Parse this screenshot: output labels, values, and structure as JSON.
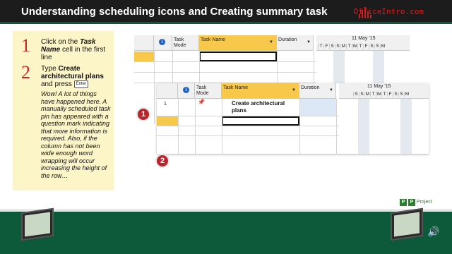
{
  "header": {
    "title": "Understanding scheduling icons and Creating summary task",
    "logo_text": "OfficeIntro.com",
    "brand_color": "#c0262c"
  },
  "steps": [
    {
      "number": "1",
      "text_pre": "Click on the ",
      "text_bold": "Task Name",
      "text_post": " cell in the first line"
    },
    {
      "number": "2",
      "text_pre": "Type ",
      "text_bold": "Create architectural plans",
      "text_post": " and press",
      "key_label": "Enter"
    }
  ],
  "note": "Wow! A lot of things have happened here. A manually scheduled task pin has appeared with a question mark indicating that more information is required. Also, if the column has not been wide enough word wrapping will occur increasing the height of the row…",
  "grid1": {
    "columns": {
      "info": "i",
      "task_mode": "Task Mode",
      "task_name": "Task Name",
      "duration": "Duration"
    },
    "timescale": {
      "week": "11 May '15",
      "days": [
        "T",
        "F",
        "S",
        "S",
        "M",
        "T",
        "W",
        "T",
        "F",
        "S",
        "S",
        "M"
      ]
    }
  },
  "grid2": {
    "columns": {
      "info": "i",
      "task_mode": "Task Mode",
      "task_name": "Task Name",
      "duration": "Duration"
    },
    "timescale": {
      "week": "11 May '15",
      "days": [
        "S",
        "S",
        "M",
        "T",
        "W",
        "T",
        "F",
        "S",
        "S",
        "M"
      ]
    },
    "rows": [
      {
        "id": "1",
        "mode_icon": "manual-pin-question-icon",
        "name": "Create architectural plans",
        "duration": ""
      }
    ]
  },
  "badges": [
    "1",
    "2"
  ],
  "footer": {
    "project_label": "Project"
  }
}
